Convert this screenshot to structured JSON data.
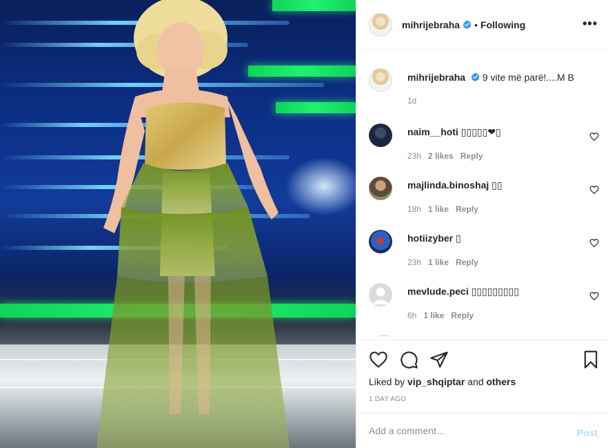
{
  "post": {
    "author": "mihrijebraha",
    "follow_status": "Following",
    "more_icon": "more-icon"
  },
  "caption": {
    "username": "mihrijebraha",
    "text": "9 vite më parë!....M B",
    "time": "1d"
  },
  "comments": [
    {
      "username": "naim__hoti",
      "text": "▯▯▯▯▯❤▯",
      "time": "23h",
      "likes": "2 likes",
      "reply": "Reply"
    },
    {
      "username": "majlinda.binoshaj",
      "text": "▯▯",
      "time": "18h",
      "likes": "1 like",
      "reply": "Reply"
    },
    {
      "username": "hotiizyber",
      "text": "▯",
      "time": "23h",
      "likes": "1 like",
      "reply": "Reply"
    },
    {
      "username": "mevlude.peci",
      "text": "▯▯▯▯▯▯▯▯▯",
      "time": "6h",
      "likes": "1 like",
      "reply": "Reply"
    }
  ],
  "actions": {
    "liked_by_prefix": "Liked by",
    "liked_by_user": "vip_shqiptar",
    "liked_by_suffix": "and",
    "others": "others",
    "date": "1 DAY AGO"
  },
  "add_comment": {
    "placeholder": "Add a comment...",
    "post_label": "Post"
  },
  "colors": {
    "verified": "#3897f0",
    "muted": "#8e8e8e",
    "post_disabled": "#b2dffc",
    "dress_green": "#7ea02a",
    "bodice_gold": "#d4b45a"
  }
}
